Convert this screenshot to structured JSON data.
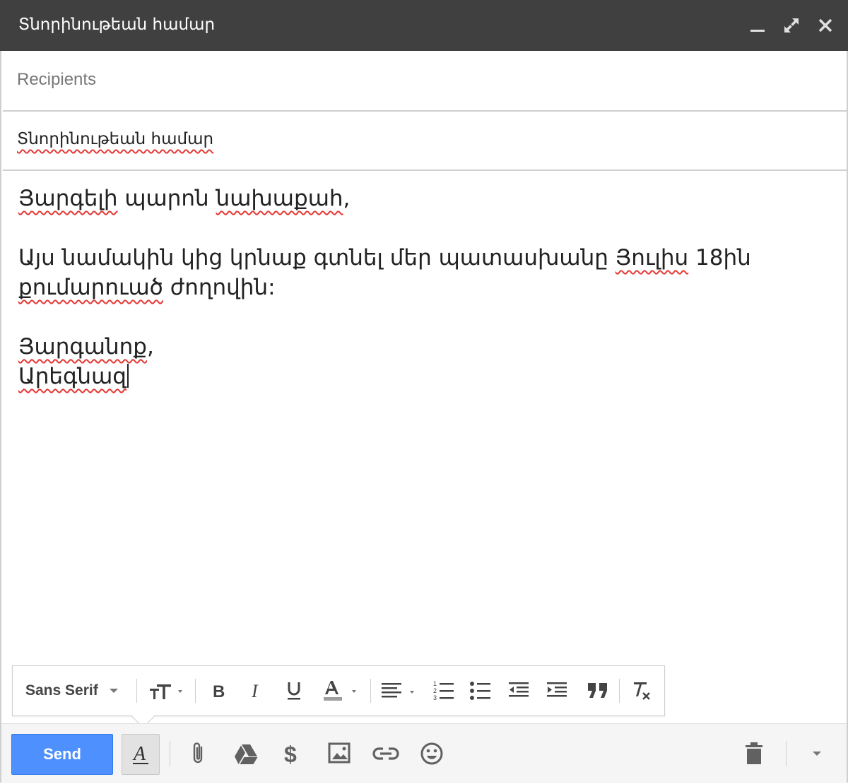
{
  "window": {
    "title": "Տնորինութեան համար",
    "minimize_icon": "minimize-icon",
    "expand_icon": "expand-icon",
    "close_icon": "close-icon"
  },
  "recipients": {
    "placeholder": "Recipients"
  },
  "subject": {
    "value": "Տնորինութեան համար"
  },
  "body": {
    "greeting_words": [
      "Յարգելի",
      " պարոն ",
      "նախաքահ",
      ","
    ],
    "para_line1_a": "Այս նամակին կից կրնաք գտնել մեր պատասխանը ",
    "para_line1_b": "Յուլիս",
    "para_line1_c": " 18ին",
    "para_line2_a": "քումարուած",
    "para_line2_b": " ժողովին:",
    "closing_a": "Յարգանոք",
    "closing_b": ",",
    "signature": "Արեգնազ"
  },
  "formatting": {
    "font_family": "Sans Serif",
    "icons": [
      "text-size-icon",
      "bold-icon",
      "italic-icon",
      "underline-icon",
      "text-color-icon",
      "align-icon",
      "numbered-list-icon",
      "bulleted-list-icon",
      "indent-less-icon",
      "indent-more-icon",
      "quote-icon",
      "remove-formatting-icon"
    ]
  },
  "actions": {
    "send_label": "Send",
    "icons": [
      "formatting-icon",
      "attach-icon",
      "drive-icon",
      "money-icon",
      "photo-icon",
      "link-icon",
      "emoji-icon",
      "trash-icon",
      "more-options-icon"
    ]
  },
  "colors": {
    "titlebar": "#404040",
    "send_button": "#4d90fe",
    "spellcheck": "#e53935"
  }
}
